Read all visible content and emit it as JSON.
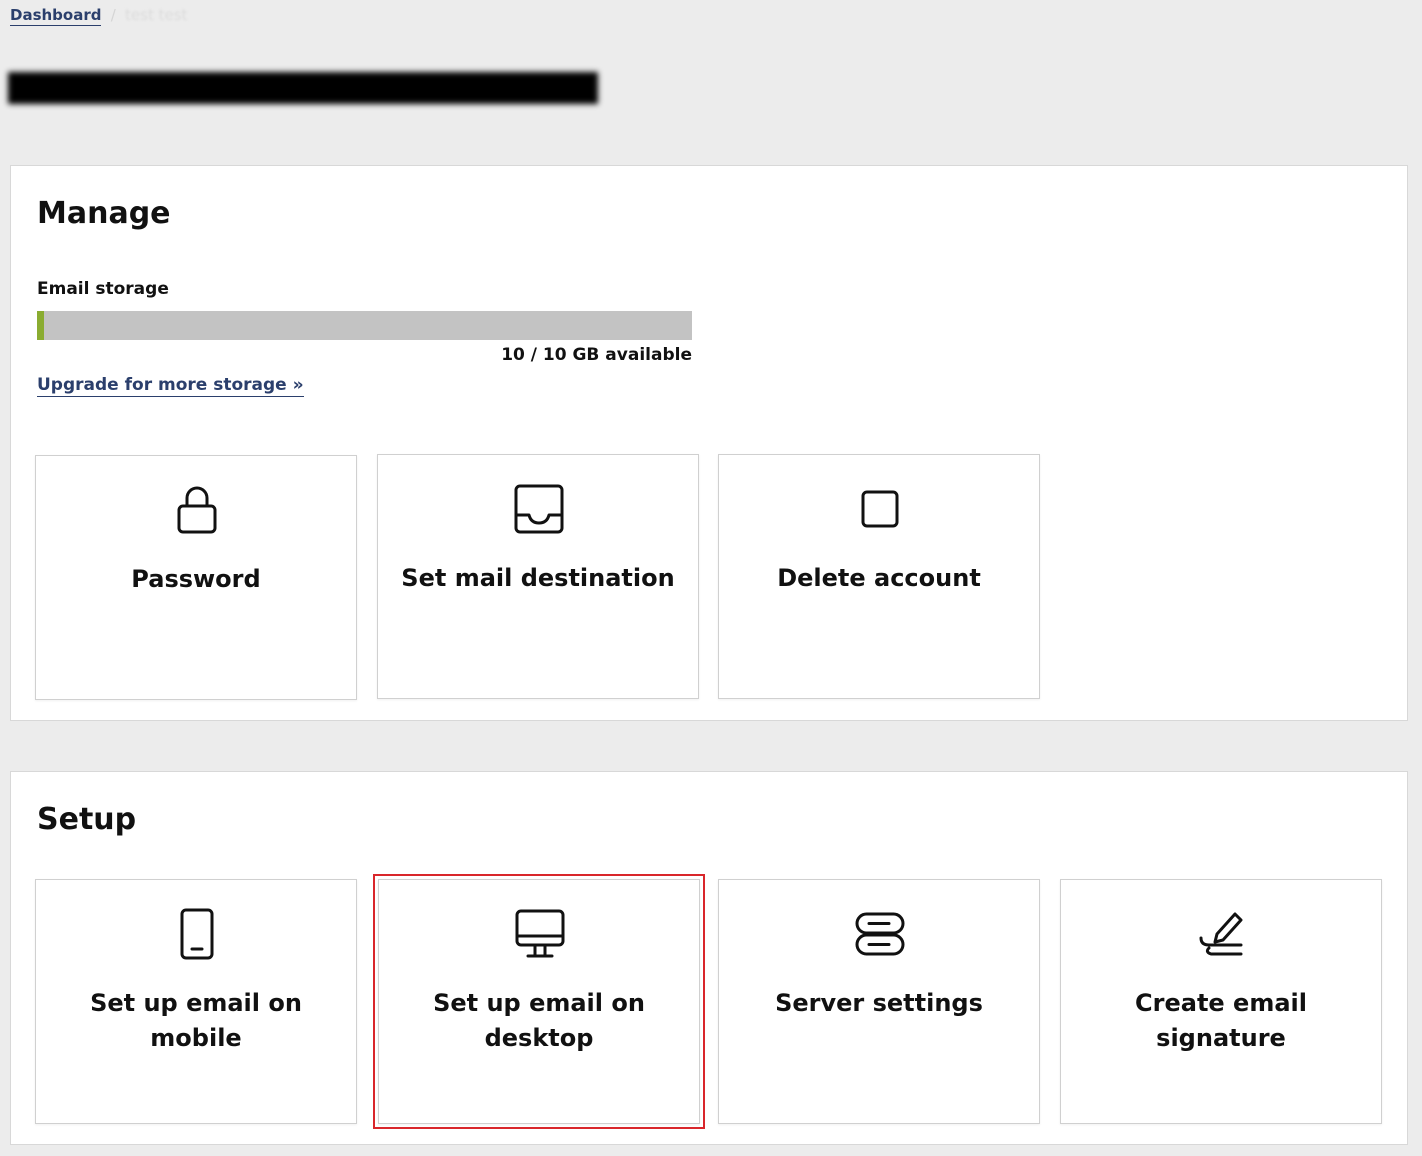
{
  "breadcrumb": {
    "home": "Dashboard",
    "separator": "/",
    "current": "test test"
  },
  "header": {
    "redacted_title": "████████████████████████"
  },
  "manage": {
    "title": "Manage",
    "storage": {
      "label": "Email storage",
      "text": "10 / 10 GB available",
      "used_fraction": 0.01,
      "bar_color": "#c3c3c3",
      "fill_color": "#8aac31"
    },
    "upgrade_link": "Upgrade for more storage »",
    "tiles": [
      {
        "label": "Password",
        "icon": "lock-icon"
      },
      {
        "label": "Set mail destination",
        "icon": "inbox-icon"
      },
      {
        "label": "Delete account",
        "icon": "square-icon"
      }
    ]
  },
  "setup": {
    "title": "Setup",
    "tiles": [
      {
        "label": "Set up email on mobile",
        "icon": "mobile-phone-icon"
      },
      {
        "label": "Set up email on desktop",
        "icon": "desktop-monitor-icon"
      },
      {
        "label": "Server settings",
        "icon": "server-icon"
      },
      {
        "label": "Create email signature",
        "icon": "signature-pen-icon"
      }
    ]
  },
  "colors": {
    "link": "#2b3f6c",
    "highlight": "#d9262b",
    "background": "#ececec"
  }
}
